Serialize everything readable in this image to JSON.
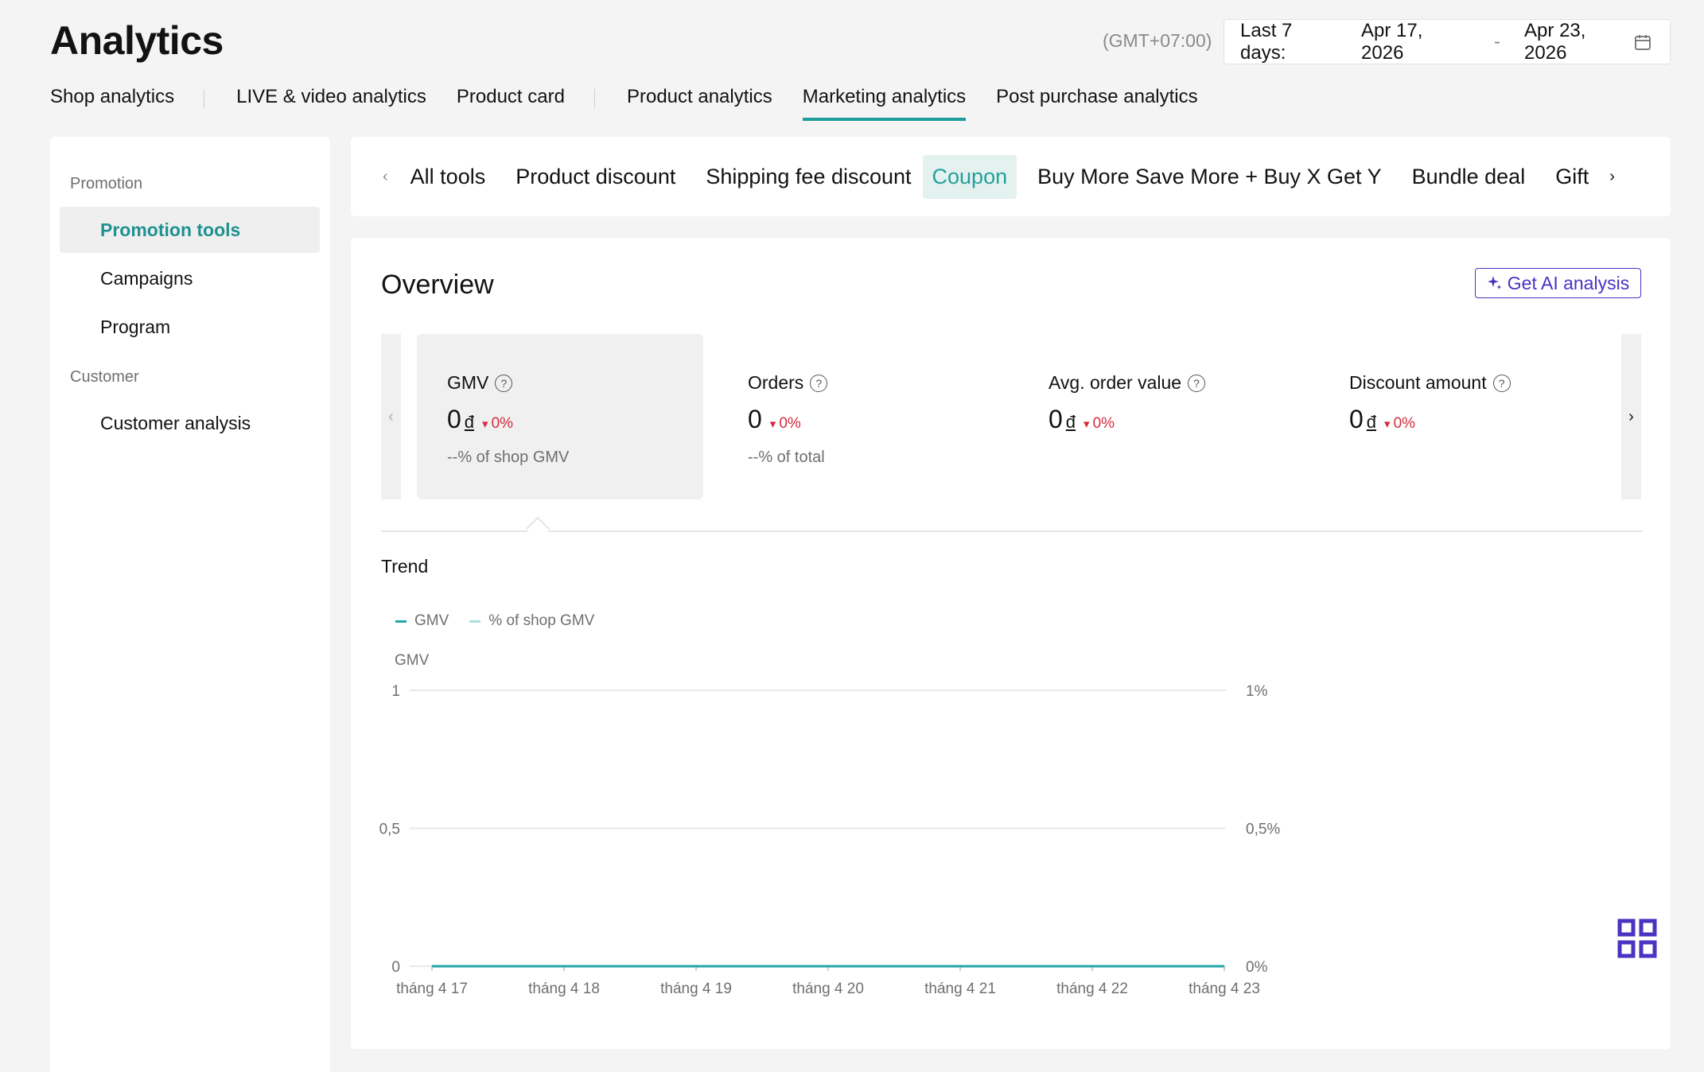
{
  "header": {
    "title": "Analytics",
    "timezone": "(GMT+07:00)",
    "date_range": {
      "label": "Last 7 days:",
      "start": "Apr 17, 2026",
      "separator": "-",
      "end": "Apr 23, 2026"
    }
  },
  "main_tabs": [
    {
      "label": "Shop analytics"
    },
    {
      "label": "LIVE & video analytics"
    },
    {
      "label": "Product card"
    },
    {
      "label": "Product analytics"
    },
    {
      "label": "Marketing analytics",
      "active": true
    },
    {
      "label": "Post purchase analytics"
    }
  ],
  "sidebar": {
    "groups": [
      {
        "label": "Promotion",
        "items": [
          {
            "label": "Promotion tools",
            "active": true
          },
          {
            "label": "Campaigns"
          },
          {
            "label": "Program"
          }
        ]
      },
      {
        "label": "Customer",
        "items": [
          {
            "label": "Customer analysis"
          }
        ]
      }
    ]
  },
  "tools_tabs": [
    "All tools",
    "Product discount",
    "Shipping fee discount",
    "Coupon",
    "Buy More Save More + Buy X Get Y",
    "Bundle deal",
    "Gift"
  ],
  "tools_active": "Coupon",
  "overview": {
    "title": "Overview",
    "ai_button": "Get AI analysis",
    "metrics": [
      {
        "name": "GMV",
        "value": "0",
        "currency": "đ",
        "delta": "0%",
        "sub": "--% of shop GMV"
      },
      {
        "name": "Orders",
        "value": "0",
        "currency": "",
        "delta": "0%",
        "sub": "--% of total"
      },
      {
        "name": "Avg. order value",
        "value": "0",
        "currency": "đ",
        "delta": "0%",
        "sub": ""
      },
      {
        "name": "Discount amount",
        "value": "0",
        "currency": "đ",
        "delta": "0%",
        "sub": ""
      }
    ]
  },
  "trend": {
    "title": "Trend",
    "legend": [
      {
        "name": "GMV",
        "color": "#23a6a6"
      },
      {
        "name": "% of shop GMV",
        "color": "#a9e0dc"
      }
    ]
  },
  "chart_data": {
    "type": "line",
    "ylabel": "GMV",
    "categories": [
      "tháng 4 17",
      "tháng 4 18",
      "tháng 4 19",
      "tháng 4 20",
      "tháng 4 21",
      "tháng 4 22",
      "tháng 4 23"
    ],
    "y_ticks": [
      "0",
      "0,5",
      "1"
    ],
    "y2_ticks": [
      "0%",
      "0,5%",
      "1%"
    ],
    "ylim": [
      0,
      1
    ],
    "y2lim": [
      0,
      1
    ],
    "series": [
      {
        "name": "GMV",
        "axis": "left",
        "values": [
          0,
          0,
          0,
          0,
          0,
          0,
          0
        ],
        "color": "#23a6a6"
      },
      {
        "name": "% of shop GMV",
        "axis": "right",
        "values": [
          0,
          0,
          0,
          0,
          0,
          0,
          0
        ],
        "color": "#a9e0dc"
      }
    ],
    "grid": true
  }
}
